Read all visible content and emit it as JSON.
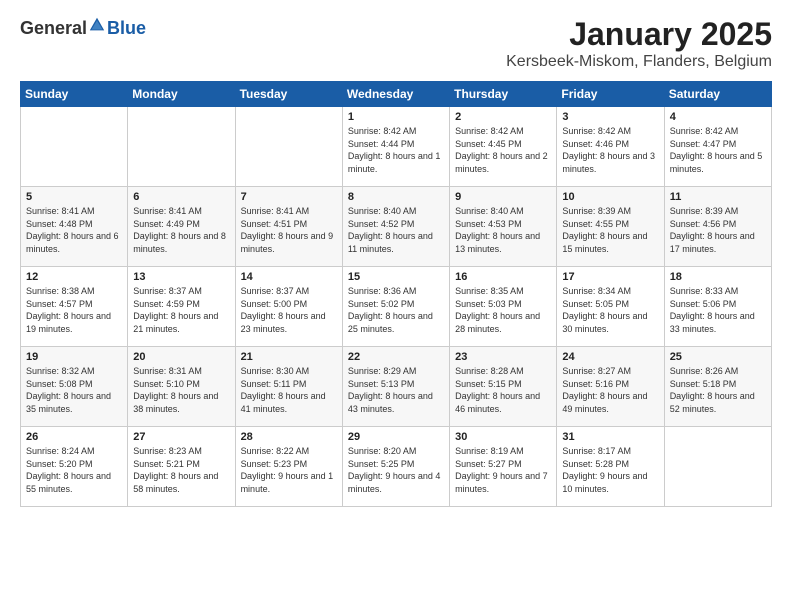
{
  "logo": {
    "general": "General",
    "blue": "Blue"
  },
  "title": "January 2025",
  "subtitle": "Kersbeek-Miskom, Flanders, Belgium",
  "headers": [
    "Sunday",
    "Monday",
    "Tuesday",
    "Wednesday",
    "Thursday",
    "Friday",
    "Saturday"
  ],
  "weeks": [
    [
      {
        "day": "",
        "sunrise": "",
        "sunset": "",
        "daylight": ""
      },
      {
        "day": "",
        "sunrise": "",
        "sunset": "",
        "daylight": ""
      },
      {
        "day": "",
        "sunrise": "",
        "sunset": "",
        "daylight": ""
      },
      {
        "day": "1",
        "sunrise": "Sunrise: 8:42 AM",
        "sunset": "Sunset: 4:44 PM",
        "daylight": "Daylight: 8 hours and 1 minute."
      },
      {
        "day": "2",
        "sunrise": "Sunrise: 8:42 AM",
        "sunset": "Sunset: 4:45 PM",
        "daylight": "Daylight: 8 hours and 2 minutes."
      },
      {
        "day": "3",
        "sunrise": "Sunrise: 8:42 AM",
        "sunset": "Sunset: 4:46 PM",
        "daylight": "Daylight: 8 hours and 3 minutes."
      },
      {
        "day": "4",
        "sunrise": "Sunrise: 8:42 AM",
        "sunset": "Sunset: 4:47 PM",
        "daylight": "Daylight: 8 hours and 5 minutes."
      }
    ],
    [
      {
        "day": "5",
        "sunrise": "Sunrise: 8:41 AM",
        "sunset": "Sunset: 4:48 PM",
        "daylight": "Daylight: 8 hours and 6 minutes."
      },
      {
        "day": "6",
        "sunrise": "Sunrise: 8:41 AM",
        "sunset": "Sunset: 4:49 PM",
        "daylight": "Daylight: 8 hours and 8 minutes."
      },
      {
        "day": "7",
        "sunrise": "Sunrise: 8:41 AM",
        "sunset": "Sunset: 4:51 PM",
        "daylight": "Daylight: 8 hours and 9 minutes."
      },
      {
        "day": "8",
        "sunrise": "Sunrise: 8:40 AM",
        "sunset": "Sunset: 4:52 PM",
        "daylight": "Daylight: 8 hours and 11 minutes."
      },
      {
        "day": "9",
        "sunrise": "Sunrise: 8:40 AM",
        "sunset": "Sunset: 4:53 PM",
        "daylight": "Daylight: 8 hours and 13 minutes."
      },
      {
        "day": "10",
        "sunrise": "Sunrise: 8:39 AM",
        "sunset": "Sunset: 4:55 PM",
        "daylight": "Daylight: 8 hours and 15 minutes."
      },
      {
        "day": "11",
        "sunrise": "Sunrise: 8:39 AM",
        "sunset": "Sunset: 4:56 PM",
        "daylight": "Daylight: 8 hours and 17 minutes."
      }
    ],
    [
      {
        "day": "12",
        "sunrise": "Sunrise: 8:38 AM",
        "sunset": "Sunset: 4:57 PM",
        "daylight": "Daylight: 8 hours and 19 minutes."
      },
      {
        "day": "13",
        "sunrise": "Sunrise: 8:37 AM",
        "sunset": "Sunset: 4:59 PM",
        "daylight": "Daylight: 8 hours and 21 minutes."
      },
      {
        "day": "14",
        "sunrise": "Sunrise: 8:37 AM",
        "sunset": "Sunset: 5:00 PM",
        "daylight": "Daylight: 8 hours and 23 minutes."
      },
      {
        "day": "15",
        "sunrise": "Sunrise: 8:36 AM",
        "sunset": "Sunset: 5:02 PM",
        "daylight": "Daylight: 8 hours and 25 minutes."
      },
      {
        "day": "16",
        "sunrise": "Sunrise: 8:35 AM",
        "sunset": "Sunset: 5:03 PM",
        "daylight": "Daylight: 8 hours and 28 minutes."
      },
      {
        "day": "17",
        "sunrise": "Sunrise: 8:34 AM",
        "sunset": "Sunset: 5:05 PM",
        "daylight": "Daylight: 8 hours and 30 minutes."
      },
      {
        "day": "18",
        "sunrise": "Sunrise: 8:33 AM",
        "sunset": "Sunset: 5:06 PM",
        "daylight": "Daylight: 8 hours and 33 minutes."
      }
    ],
    [
      {
        "day": "19",
        "sunrise": "Sunrise: 8:32 AM",
        "sunset": "Sunset: 5:08 PM",
        "daylight": "Daylight: 8 hours and 35 minutes."
      },
      {
        "day": "20",
        "sunrise": "Sunrise: 8:31 AM",
        "sunset": "Sunset: 5:10 PM",
        "daylight": "Daylight: 8 hours and 38 minutes."
      },
      {
        "day": "21",
        "sunrise": "Sunrise: 8:30 AM",
        "sunset": "Sunset: 5:11 PM",
        "daylight": "Daylight: 8 hours and 41 minutes."
      },
      {
        "day": "22",
        "sunrise": "Sunrise: 8:29 AM",
        "sunset": "Sunset: 5:13 PM",
        "daylight": "Daylight: 8 hours and 43 minutes."
      },
      {
        "day": "23",
        "sunrise": "Sunrise: 8:28 AM",
        "sunset": "Sunset: 5:15 PM",
        "daylight": "Daylight: 8 hours and 46 minutes."
      },
      {
        "day": "24",
        "sunrise": "Sunrise: 8:27 AM",
        "sunset": "Sunset: 5:16 PM",
        "daylight": "Daylight: 8 hours and 49 minutes."
      },
      {
        "day": "25",
        "sunrise": "Sunrise: 8:26 AM",
        "sunset": "Sunset: 5:18 PM",
        "daylight": "Daylight: 8 hours and 52 minutes."
      }
    ],
    [
      {
        "day": "26",
        "sunrise": "Sunrise: 8:24 AM",
        "sunset": "Sunset: 5:20 PM",
        "daylight": "Daylight: 8 hours and 55 minutes."
      },
      {
        "day": "27",
        "sunrise": "Sunrise: 8:23 AM",
        "sunset": "Sunset: 5:21 PM",
        "daylight": "Daylight: 8 hours and 58 minutes."
      },
      {
        "day": "28",
        "sunrise": "Sunrise: 8:22 AM",
        "sunset": "Sunset: 5:23 PM",
        "daylight": "Daylight: 9 hours and 1 minute."
      },
      {
        "day": "29",
        "sunrise": "Sunrise: 8:20 AM",
        "sunset": "Sunset: 5:25 PM",
        "daylight": "Daylight: 9 hours and 4 minutes."
      },
      {
        "day": "30",
        "sunrise": "Sunrise: 8:19 AM",
        "sunset": "Sunset: 5:27 PM",
        "daylight": "Daylight: 9 hours and 7 minutes."
      },
      {
        "day": "31",
        "sunrise": "Sunrise: 8:17 AM",
        "sunset": "Sunset: 5:28 PM",
        "daylight": "Daylight: 9 hours and 10 minutes."
      },
      {
        "day": "",
        "sunrise": "",
        "sunset": "",
        "daylight": ""
      }
    ]
  ]
}
